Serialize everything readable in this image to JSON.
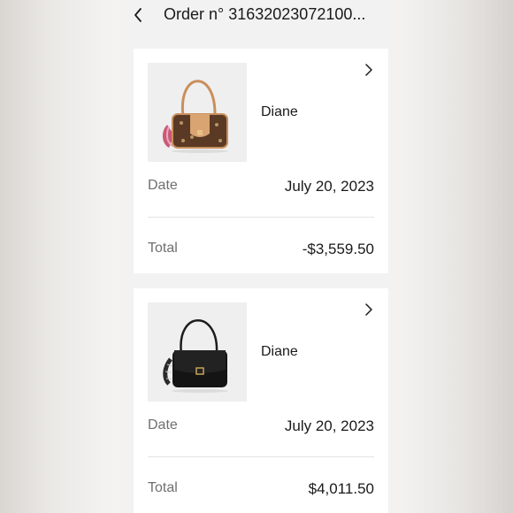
{
  "header": {
    "back_icon": "chevron-left-icon",
    "title": "Order n° 31632023072100..."
  },
  "orders": [
    {
      "product_name": "Diane",
      "product_image": "monogram-canvas-shoulder-bag",
      "date_label": "Date",
      "date_value": "July 20, 2023",
      "total_label": "Total",
      "total_value": "-$3,559.50",
      "chevron_icon": "chevron-right-icon"
    },
    {
      "product_name": "Diane",
      "product_image": "black-leather-shoulder-bag",
      "date_label": "Date",
      "date_value": "July 20, 2023",
      "total_label": "Total",
      "total_value": "$4,011.50",
      "chevron_icon": "chevron-right-icon"
    }
  ],
  "colors": {
    "background": "#f2f2f2",
    "card": "#ffffff",
    "text": "#1a1a1a",
    "label": "#6f6f6f"
  }
}
